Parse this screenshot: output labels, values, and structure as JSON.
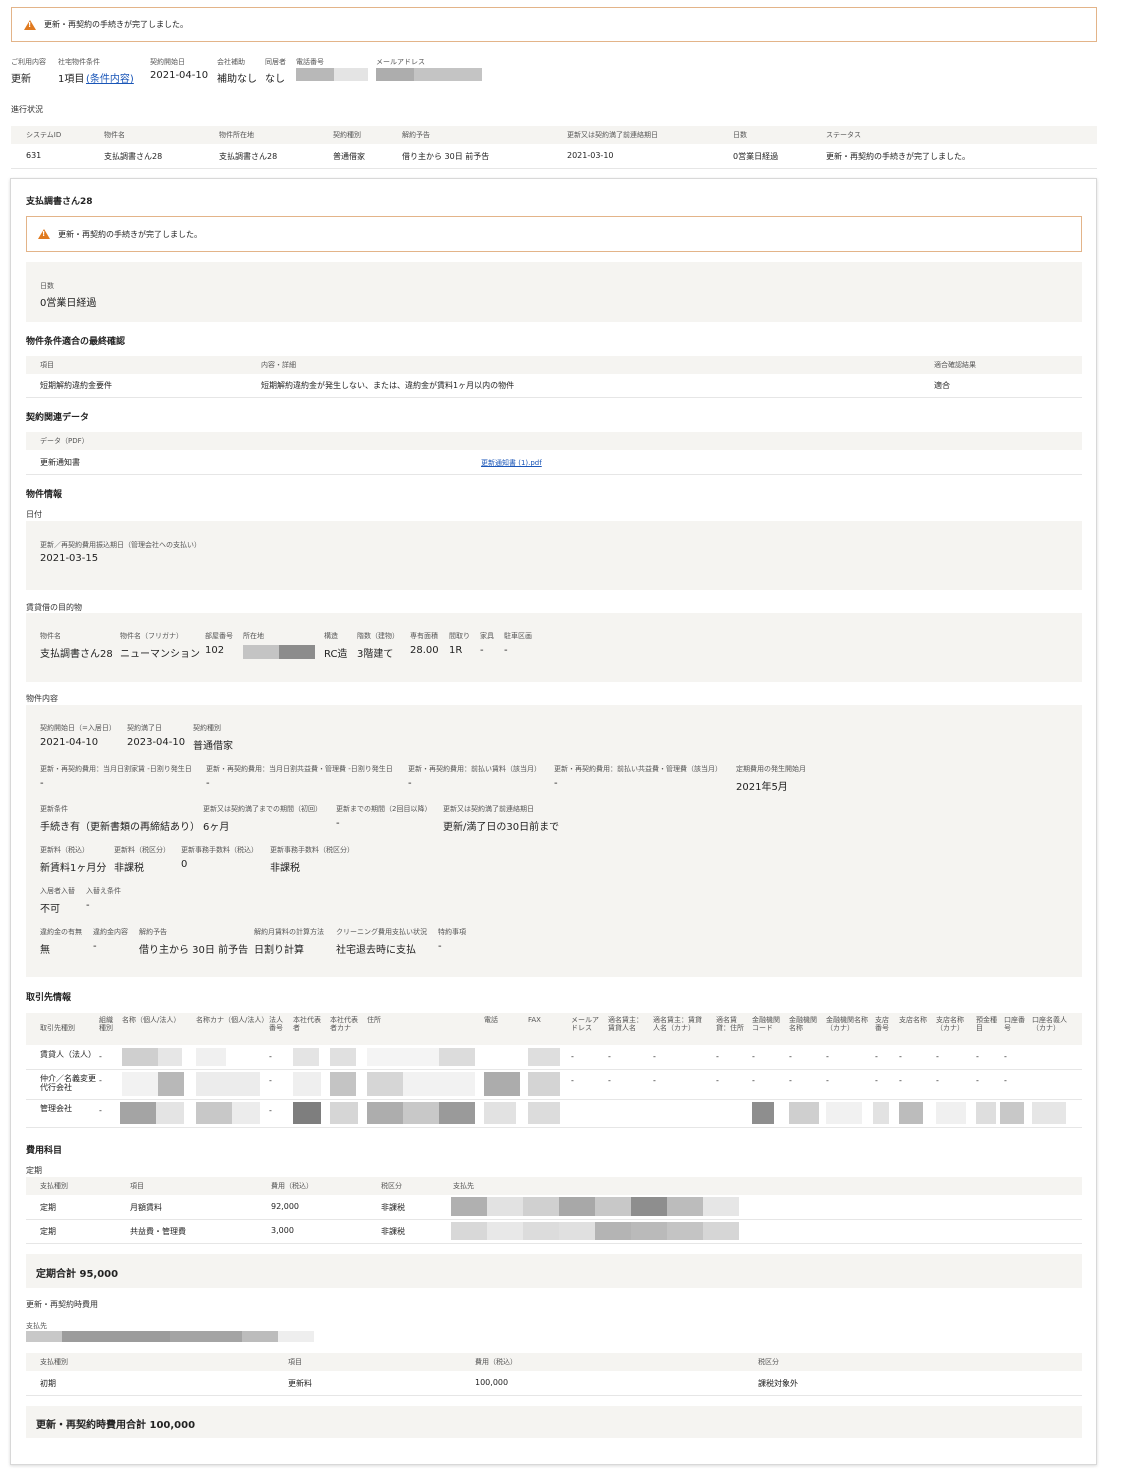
{
  "alert_top": "更新・再契約の手続きが完了しました。",
  "summary": {
    "headers": [
      "ご利用内容",
      "社宅物件条件",
      "契約開始日",
      "会社補助",
      "同居者",
      "電話番号",
      "メールアドレス"
    ],
    "usage": "更新",
    "cond_count": "1項目",
    "cond_link": "(条件内容)",
    "start": "2021-04-10",
    "subsidy": "補助なし",
    "cohabitant": "なし"
  },
  "progress": {
    "title": "進行状況",
    "headers": [
      "システムID",
      "物件名",
      "物件所在地",
      "契約種別",
      "解約予告",
      "更新又は契約満了前連絡期日",
      "日数",
      "ステータス"
    ],
    "row": [
      "631",
      "支払調書さん28",
      "支払調書さん28",
      "普通借家",
      "借り主から 30日 前予告",
      "2021-03-10",
      "0営業日経過",
      "更新・再契約の手続きが完了しました。"
    ]
  },
  "card": {
    "title": "支払調書さん28",
    "alert": "更新・再契約の手続きが完了しました。",
    "days_label": "日数",
    "days_value": "0営業日経過",
    "final_check": {
      "title": "物件条件適合の最終確認",
      "headers": [
        "項目",
        "内容・詳細",
        "適合確認結果"
      ],
      "row": [
        "短期解約違約金要件",
        "短期解約違約金が発生しない、または、違約金が賃料1ヶ月以内の物件",
        "適合"
      ]
    },
    "contract_data": {
      "title": "契約関連データ",
      "header": "データ（PDF）",
      "row_label": "更新通知書",
      "file": "更新通知書 (1).pdf"
    },
    "property_info": {
      "title": "物件情報",
      "date_title": "日付",
      "date_label": "更新／再契約費用振込期日（管理会社への支払い）",
      "date_value": "2021-03-15",
      "target_title": "賃貸借の目的物",
      "target_labels": [
        "物件名",
        "物件名（フリガナ）",
        "部屋番号",
        "所在地",
        "構造",
        "階数（建物）",
        "専有面積",
        "間取り",
        "家具",
        "駐車区画"
      ],
      "target_values": [
        "支払調書さん28",
        "ニューマンション",
        "102",
        "",
        "RC造",
        "3階建て",
        "28.00",
        "1R",
        "-",
        "-"
      ],
      "content_title": "物件内容",
      "r1_labels": [
        "契約開始日（=入居日）",
        "契約満了日",
        "契約種別"
      ],
      "r1_values": [
        "2021-04-10",
        "2023-04-10",
        "普通借家"
      ],
      "r2_labels": [
        "更新・再契約費用：当月日割家賃 -日割り発生日",
        "更新・再契約費用：当月日割共益費・管理費 -日割り発生日",
        "更新・再契約費用：前払い賃料（該当月）",
        "更新・再契約費用：前払い共益費・管理費（該当月）",
        "定期費用の発生開始月"
      ],
      "r2_values": [
        "-",
        "-",
        "-",
        "-",
        "2021年5月"
      ],
      "r3_labels": [
        "更新条件",
        "更新又は契約満了までの期間（初回）",
        "更新までの期間（2回目以降）",
        "更新又は契約満了前連絡期日"
      ],
      "r3_values": [
        "手続き有（更新書類の再締結あり）",
        "6ヶ月",
        "-",
        "更新/満了日の30日前まで"
      ],
      "r4_labels": [
        "更新料（税込）",
        "更新料（税区分）",
        "更新事務手数料（税込）",
        "更新事務手数料（税区分）"
      ],
      "r4_values": [
        "新賃料1ヶ月分",
        "非課税",
        "0",
        "非課税"
      ],
      "r5_labels": [
        "入居者入替",
        "入替え条件"
      ],
      "r5_values": [
        "不可",
        "-"
      ],
      "r6_labels": [
        "違約金の有無",
        "違約金内容",
        "解約予告",
        "解約月賃料の計算方法",
        "クリーニング費用支払い状況",
        "特約事項"
      ],
      "r6_values": [
        "無",
        "-",
        "借り主から 30日 前予告",
        "日割り計算",
        "社宅退去時に支払",
        "-"
      ]
    },
    "partners": {
      "title": "取引先情報",
      "headers": [
        "取引先種別",
        "組織種別",
        "名称（個人/法人）",
        "名称カナ（個人/法人）",
        "法人番号",
        "本社代表者",
        "本社代表者カナ",
        "住所",
        "電話",
        "FAX",
        "メールアドレス",
        "適名賃主：賃貸人名",
        "適名賃主：賃貸人名（カナ）",
        "適名賃貸：住所",
        "金融機関コード",
        "金融機関名称",
        "金融機関名称（カナ）",
        "支店番号",
        "支店名称",
        "支店名称（カナ）",
        "預金種目",
        "口座番号",
        "口座名義人（カナ）"
      ],
      "rows": [
        {
          "type": "賃貸人（法人）",
          "dash": "-"
        },
        {
          "type": "仲介／名義変更代行会社",
          "dash": "-"
        },
        {
          "type": "管理会社",
          "dash": "-"
        }
      ]
    },
    "costs": {
      "title": "費用科目",
      "periodic_title": "定期",
      "headers": [
        "支払種別",
        "項目",
        "費用（税込）",
        "税区分",
        "支払先"
      ],
      "rows": [
        [
          "定期",
          "月額賃料",
          "92,000",
          "非課税"
        ],
        [
          "定期",
          "共益費・管理費",
          "3,000",
          "非課税"
        ]
      ],
      "periodic_total": "定期合計 95,000",
      "renewal_title": "更新・再契約時費用",
      "payee_label": "支払先",
      "renewal_headers": [
        "支払種別",
        "項目",
        "費用（税込）",
        "税区分"
      ],
      "renewal_row": [
        "初期",
        "更新料",
        "100,000",
        "課税対象外"
      ],
      "renewal_total": "更新・再契約時費用合計 100,000"
    }
  }
}
